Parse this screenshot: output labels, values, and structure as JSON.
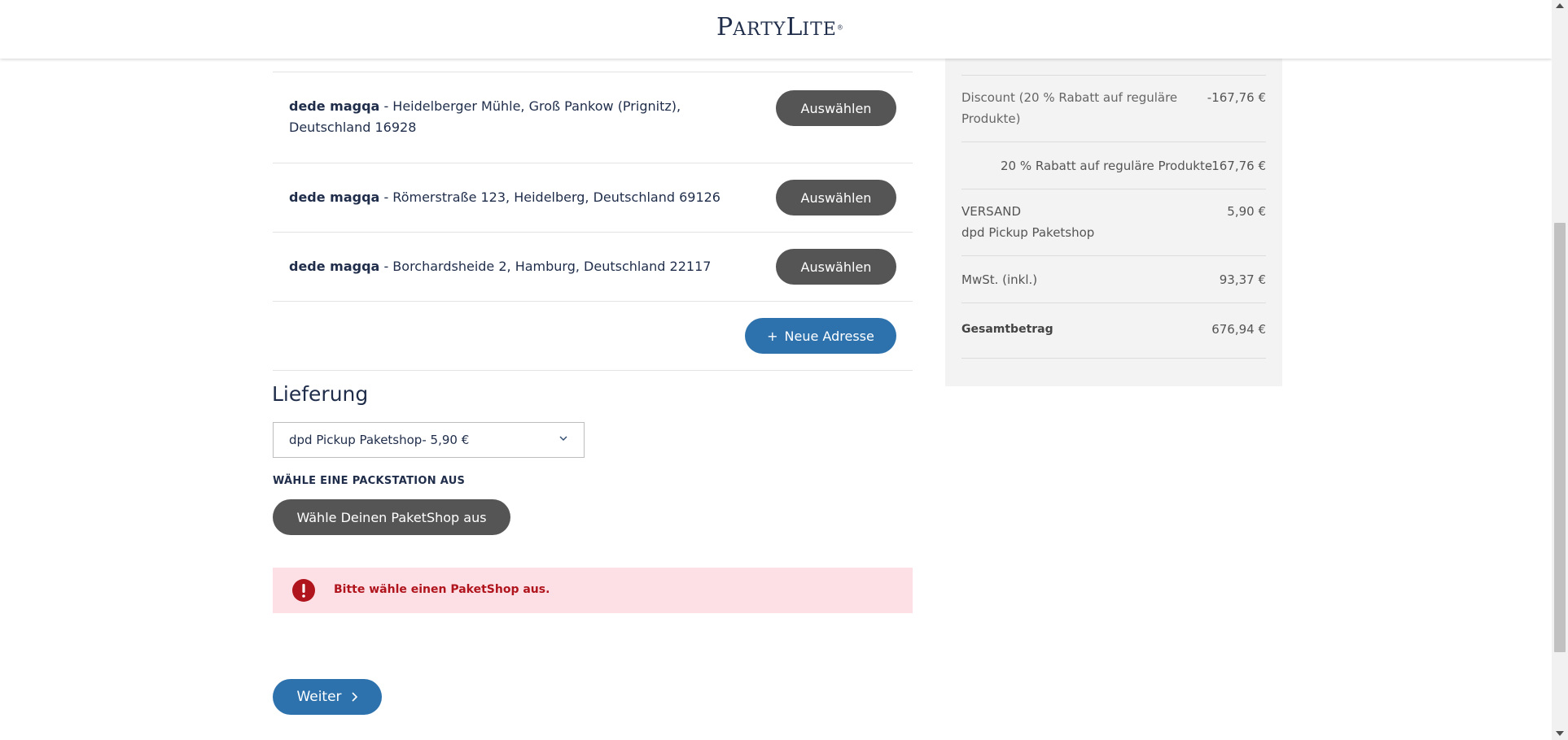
{
  "brand": {
    "logo_first": "P",
    "logo_rest": "ARTY",
    "logo_second": "L",
    "logo_end": "ITE",
    "logo_reg": "®"
  },
  "addresses": [
    {
      "name": "dede magqa",
      "address": " - Heidelberger Mühle, Groß Pankow (Prignitz), Deutschland 16928",
      "button": "Auswählen"
    },
    {
      "name": "dede magqa",
      "address": " - Römerstraße 123, Heidelberg, Deutschland 69126",
      "button": "Auswählen"
    },
    {
      "name": "dede magqa",
      "address": " - Borchardsheide 2, Hamburg, Deutschland 22117",
      "button": "Auswählen"
    }
  ],
  "new_address": {
    "icon": "+",
    "label": "Neue Adresse"
  },
  "delivery": {
    "title": "Lieferung",
    "selected_option": "dpd Pickup Paketshop",
    "selected_price": " - 5,90 €",
    "packstation_label": "WÄHLE EINE PACKSTATION AUS",
    "paketshop_button": "Wähle Deinen PaketShop aus"
  },
  "alert": {
    "icon": "!",
    "message": "Bitte wähle einen PaketShop aus.",
    "color": "#b0141d"
  },
  "continue_button": "Weiter",
  "summary": {
    "discount_label": "Discount (20 % Rabatt auf reguläre Produkte)",
    "discount_value": "-167,76 €",
    "discount_detail_label": "20 % Rabatt auf reguläre Produkte",
    "discount_detail_value": "-167,76 €",
    "shipping_label": "VERSAND",
    "shipping_method": "dpd Pickup Paketshop",
    "shipping_value": "5,90 €",
    "tax_label": "MwSt. (inkl.)",
    "tax_value": "93,37 €",
    "total_label": "Gesamtbetrag",
    "total_value": "676,94 €"
  },
  "colors": {
    "primary_blue": "#2d72ad",
    "dark_button": "#555555",
    "alert_bg": "#fde0e5",
    "text_navy": "#1f2d4a"
  }
}
